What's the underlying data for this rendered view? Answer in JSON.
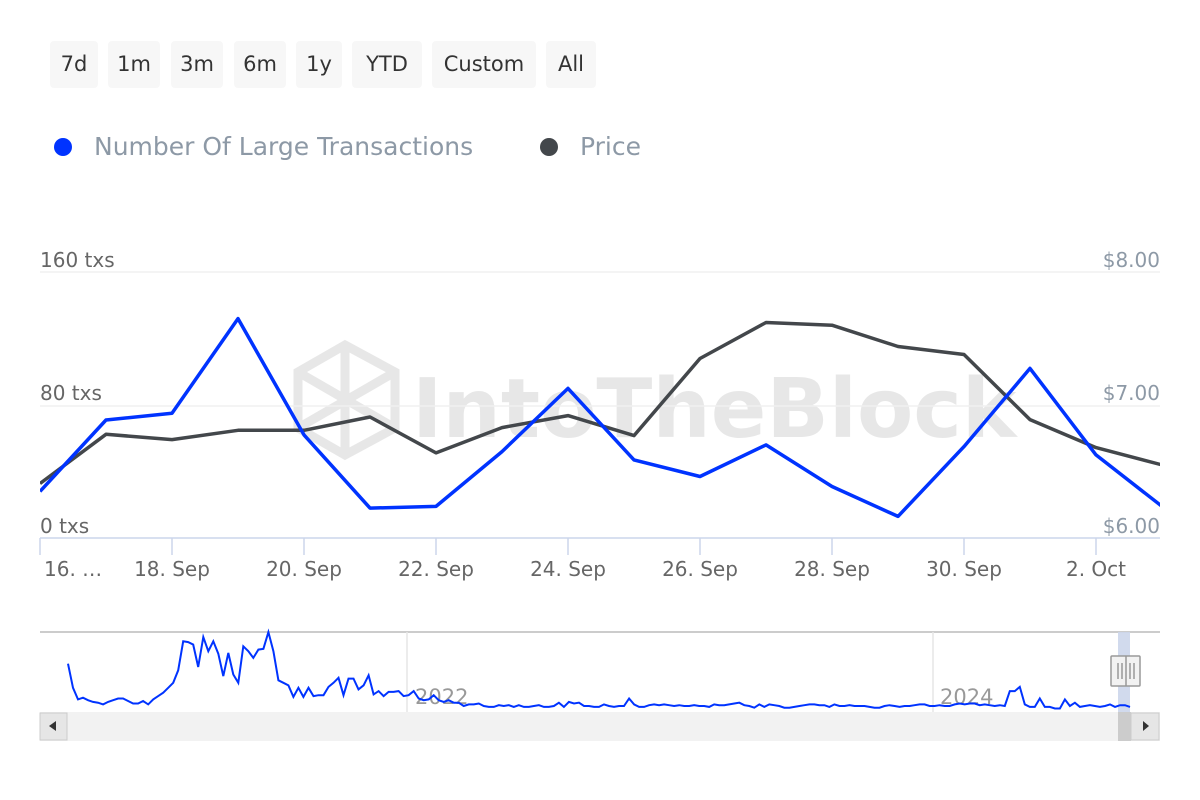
{
  "range_selector": {
    "buttons": [
      {
        "label": "7d"
      },
      {
        "label": "1m"
      },
      {
        "label": "3m"
      },
      {
        "label": "6m"
      },
      {
        "label": "1y"
      },
      {
        "label": "YTD"
      },
      {
        "label": "Custom"
      },
      {
        "label": "All"
      }
    ]
  },
  "legend": [
    {
      "label": "Number Of Large Transactions",
      "color": "#0033ff"
    },
    {
      "label": "Price",
      "color": "#43474b"
    }
  ],
  "watermark": "IntoTheBlock",
  "chart_data": {
    "type": "line",
    "title": "",
    "xlabel": "",
    "x": [
      "16. Sep",
      "17. Sep",
      "18. Sep",
      "19. Sep",
      "20. Sep",
      "21. Sep",
      "22. Sep",
      "23. Sep",
      "24. Sep",
      "25. Sep",
      "26. Sep",
      "27. Sep",
      "28. Sep",
      "29. Sep",
      "30. Sep",
      "1. Oct",
      "2. Oct",
      "3. Oct"
    ],
    "x_tick_labels": [
      "16. …",
      "18. Sep",
      "20. Sep",
      "22. Sep",
      "24. Sep",
      "26. Sep",
      "28. Sep",
      "30. Sep",
      "2. Oct"
    ],
    "x_tick_indices": [
      0,
      2,
      4,
      6,
      8,
      10,
      12,
      14,
      16
    ],
    "series": [
      {
        "name": "Number Of Large Transactions",
        "axis": "left",
        "color": "#0033ff",
        "values": [
          28,
          71,
          75,
          132,
          62,
          18,
          19,
          52,
          90,
          47,
          37,
          56,
          31,
          13,
          55,
          102,
          50,
          19
        ]
      },
      {
        "name": "Price",
        "axis": "right",
        "color": "#43474b",
        "values": [
          6.41,
          6.78,
          6.74,
          6.81,
          6.81,
          6.91,
          6.64,
          6.83,
          6.92,
          6.77,
          7.35,
          7.62,
          7.6,
          7.44,
          7.38,
          6.89,
          6.68,
          6.55
        ]
      }
    ],
    "y_left": {
      "ylim": [
        0,
        160
      ],
      "ticks": [
        0,
        80,
        160
      ],
      "tick_labels": [
        "0 txs",
        "80 txs",
        "160 txs"
      ]
    },
    "y_right": {
      "ylim": [
        6,
        8
      ],
      "ticks": [
        6,
        7,
        8
      ],
      "tick_labels": [
        "$6.00",
        "$7.00",
        "$8.00"
      ]
    },
    "grid": true,
    "legend_position": "top-left",
    "navigator": {
      "series_name": "Number Of Large Transactions",
      "year_labels": [
        "2022",
        "2024"
      ],
      "values": [
        57,
        28,
        14,
        16,
        13,
        11,
        10,
        8,
        11,
        13,
        15,
        15,
        12,
        9,
        9,
        12,
        8,
        14,
        18,
        22,
        28,
        34,
        49,
        84,
        83,
        80,
        53,
        89,
        72,
        84,
        69,
        42,
        70,
        44,
        34,
        78,
        72,
        64,
        74,
        75,
        95,
        72,
        37,
        34,
        31,
        17,
        28,
        17,
        28,
        18,
        19,
        19,
        29,
        34,
        40,
        19,
        39,
        39,
        26,
        31,
        43,
        20,
        24,
        18,
        23,
        23,
        24,
        18,
        19,
        24,
        15,
        13,
        14,
        19,
        13,
        11,
        13,
        10,
        10,
        6,
        8,
        8,
        9,
        6,
        5,
        5,
        7,
        6,
        7,
        5,
        7,
        5,
        5,
        6,
        7,
        5,
        5,
        6,
        10,
        5,
        11,
        9,
        10,
        6,
        6,
        5,
        5,
        8,
        6,
        5,
        6,
        6,
        15,
        8,
        5,
        5,
        7,
        8,
        7,
        8,
        7,
        6,
        7,
        6,
        6,
        7,
        6,
        6,
        5,
        8,
        7,
        7,
        8,
        9,
        10,
        7,
        6,
        4,
        8,
        5,
        8,
        7,
        6,
        4,
        4,
        5,
        6,
        7,
        8,
        8,
        7,
        7,
        5,
        8,
        6,
        6,
        7,
        6,
        6,
        6,
        5,
        4,
        4,
        6,
        7,
        6,
        5,
        6,
        6,
        7,
        8,
        8,
        6,
        6,
        7,
        6,
        6,
        8,
        9,
        8,
        9,
        9,
        7,
        8,
        7,
        6,
        7,
        6,
        24,
        24,
        29,
        8,
        5,
        5,
        15,
        5,
        5,
        3,
        3,
        14,
        6,
        10,
        5,
        6,
        7,
        6,
        5,
        6,
        8,
        5,
        7,
        7,
        5
      ]
    }
  }
}
